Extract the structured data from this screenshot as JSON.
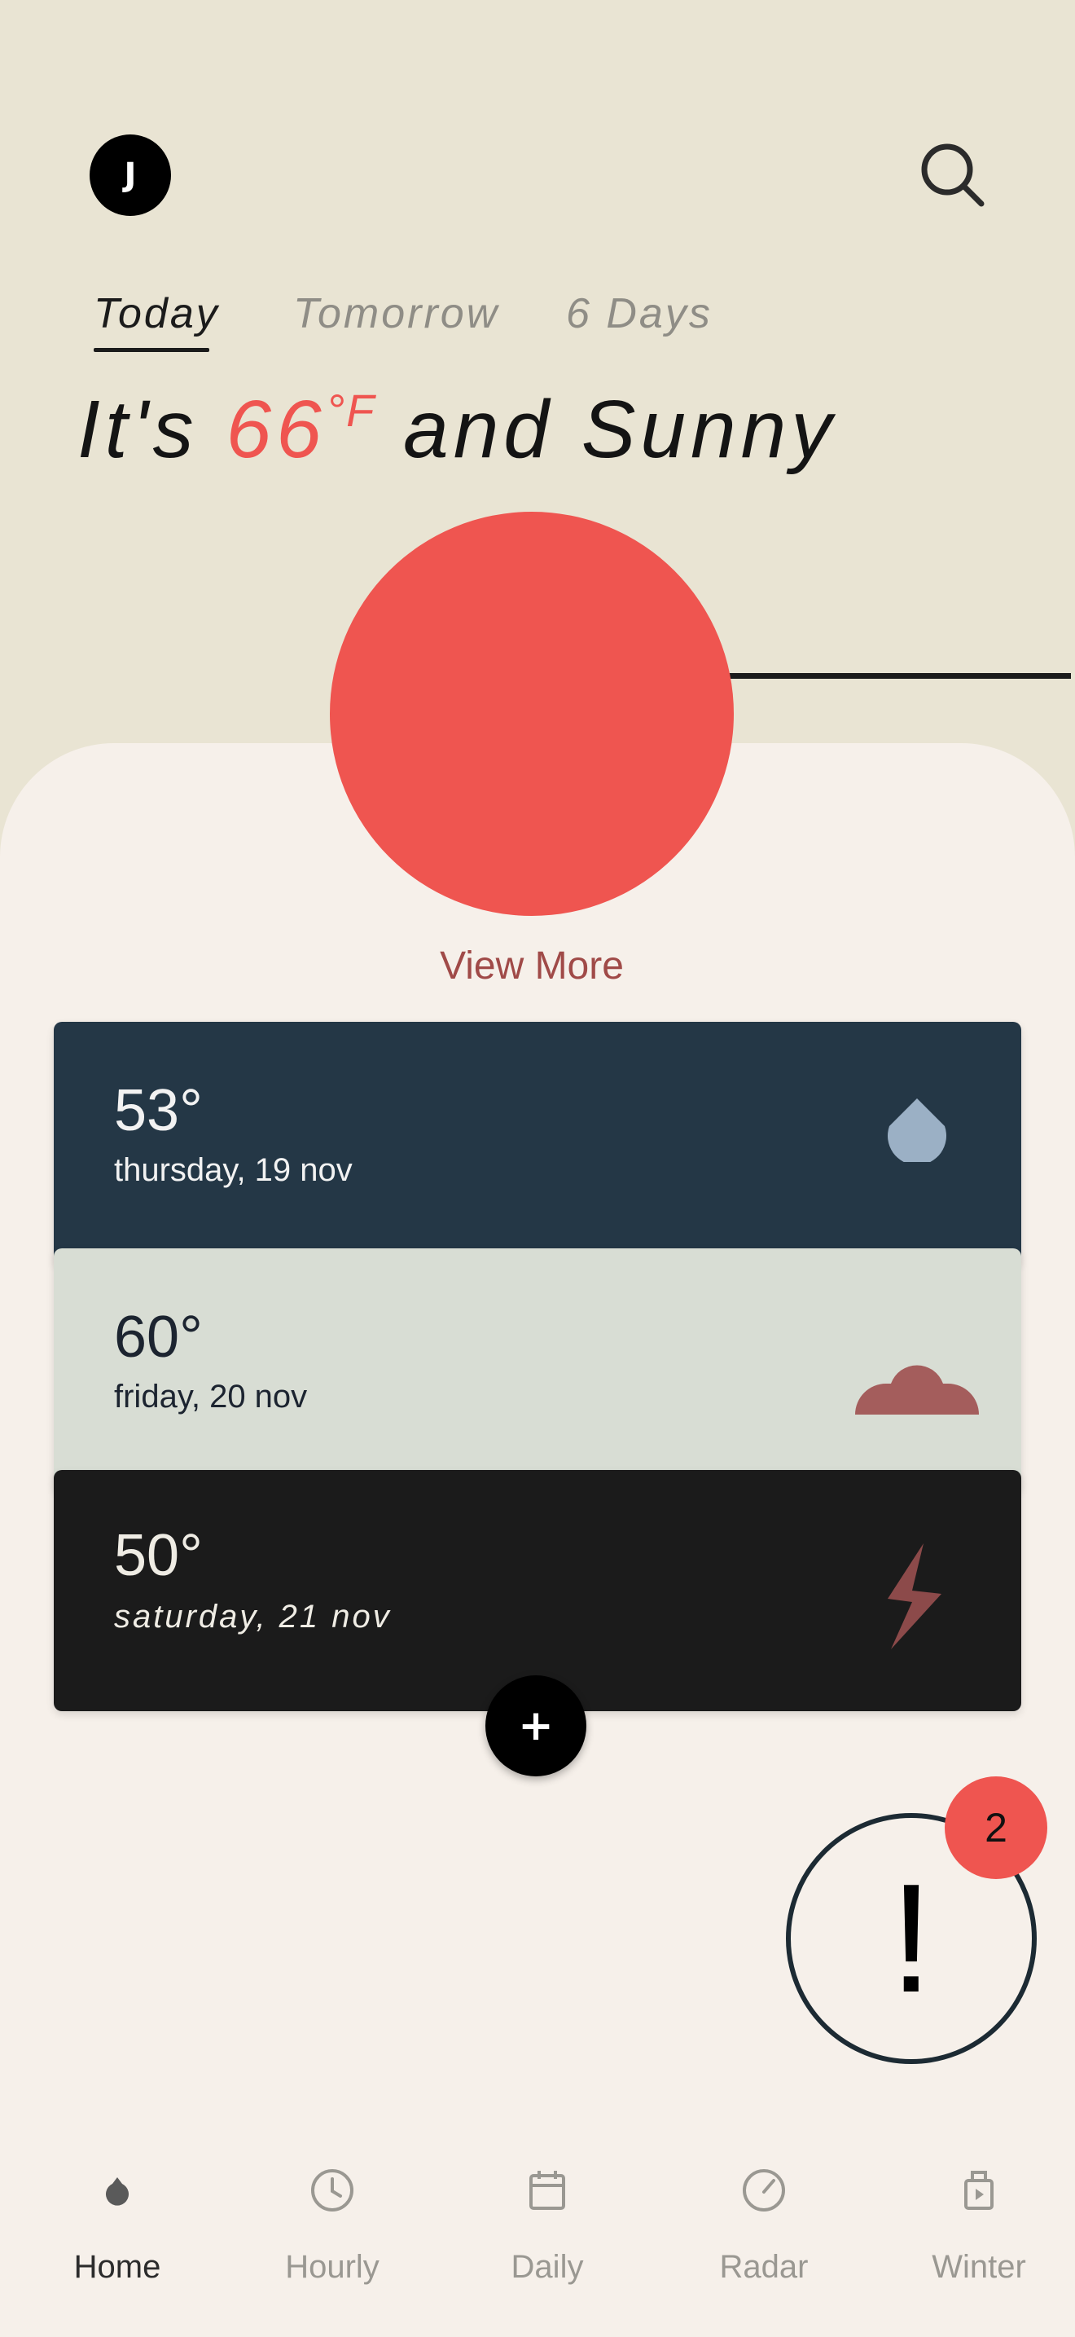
{
  "header": {
    "avatar_initial": "J",
    "search_icon": "search-icon"
  },
  "tabs": [
    {
      "label": "Today",
      "active": true
    },
    {
      "label": "Tomorrow",
      "active": false
    },
    {
      "label": "6 Days",
      "active": false
    }
  ],
  "headline": {
    "prefix": "It's ",
    "temperature": "66",
    "unit": "°F",
    "suffix": " and Sunny"
  },
  "view_more_label": "View More",
  "forecast": [
    {
      "temp": "53°",
      "date": "thursday, 19 nov",
      "icon": "raindrop-icon",
      "card_color": "#243746",
      "icon_color": "#9bb0c5"
    },
    {
      "temp": "60°",
      "date": "friday, 20 nov",
      "icon": "cloud-icon",
      "card_color": "#d8ddd4",
      "icon_color": "#a45d5c"
    },
    {
      "temp": "50°",
      "date": "saturday, 21 nov",
      "icon": "lightning-icon",
      "card_color": "#1b1b1b",
      "icon_color": "#8c4a4a"
    }
  ],
  "add_button_label": "+",
  "alert": {
    "symbol": "!",
    "count": "2"
  },
  "bottom_nav": [
    {
      "label": "Home",
      "icon": "home-drop-icon",
      "active": true
    },
    {
      "label": "Hourly",
      "icon": "clock-icon",
      "active": false
    },
    {
      "label": "Daily",
      "icon": "calendar-icon",
      "active": false
    },
    {
      "label": "Radar",
      "icon": "gauge-icon",
      "active": false
    },
    {
      "label": "Winter",
      "icon": "winter-icon",
      "active": false
    }
  ],
  "colors": {
    "background_top": "#e9e4d3",
    "background_sheet": "#f6f0ea",
    "accent": "#ef5550"
  }
}
